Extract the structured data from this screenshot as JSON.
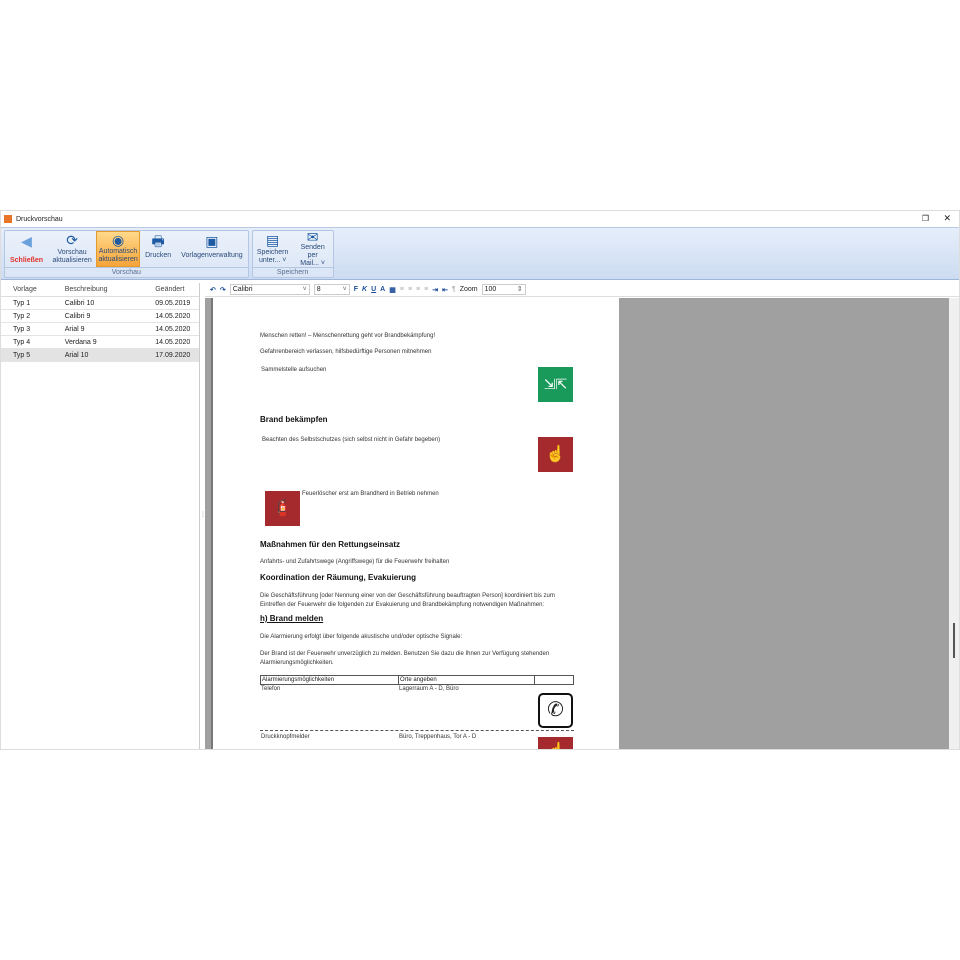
{
  "window": {
    "title": "Druckvorschau"
  },
  "ribbon": {
    "groups": [
      {
        "label": "Vorschau"
      },
      {
        "label": "Speichern"
      }
    ],
    "buttons": {
      "close": "Schließen",
      "refresh": "Vorschau aktualisieren",
      "auto": "Automatisch aktualisieren",
      "print": "Drucken",
      "templates": "Vorlagenverwaltung",
      "save": "Speichern unter... ˅",
      "mail": "Senden per Mail... ˅"
    }
  },
  "templates": {
    "headers": [
      "Vorlage",
      "Beschreibung",
      "Geändert"
    ],
    "rows": [
      [
        "Typ 1",
        "Calibri 10",
        "09.05.2019"
      ],
      [
        "Typ 2",
        "Calibri 9",
        "14.05.2020"
      ],
      [
        "Typ 3",
        "Arial 9",
        "14.05.2020"
      ],
      [
        "Typ 4",
        "Verdana 9",
        "14.05.2020"
      ],
      [
        "Typ 5",
        "Arial 10",
        "17.09.2020"
      ]
    ]
  },
  "editor": {
    "font": "Calibri",
    "size": "8",
    "bold": "F",
    "italic": "K",
    "underline": "U",
    "color": "A",
    "pilcrow": "¶",
    "zoom_label": "Zoom",
    "zoom": "100"
  },
  "document": {
    "p1": "Menschen retten! – Menschenrettung geht vor Brandbekämpfung!",
    "p2": "Gefahrenbereich verlassen, hilfsbedürftige Personen mitnehmen",
    "p3": "Sammelstelle aufsuchen",
    "h1": "Brand bekämpfen",
    "p4": "Beachten des Selbstschutzes (sich selbst nicht in Gefahr begeben)",
    "p5": "Feuerlöscher erst am Brandherd in Betrieb nehmen",
    "h2": "Maßnahmen für den Rettungseinsatz",
    "p6": "Anfahrts- und Zufahrtswege (Angriffswege) für die Feuerwehr freihalten",
    "h3": "Koordination der Räumung, Evakuierung",
    "p7": "Die Geschäftsführung [oder Nennung einer von der Geschäftsführung beauftragten Person] koordiniert bis zum Eintreffen der Feuerwehr die folgenden zur Evakuierung und Brandbekämpfung notwendigen Maßnahmen:",
    "h4": "h) Brand melden",
    "p8": "Die Alarmierung erfolgt über folgende akustische und/oder optische Signale:",
    "p9": "Der Brand ist der Feuerwehr unverzüglich zu melden. Benutzen Sie dazu die Ihnen zur Verfügung stehenden Alarmierungsmöglichkeiten.",
    "table": {
      "headers": [
        "Alarmierungsmöglichkeiten",
        "Orte angeben",
        ""
      ],
      "rows": [
        [
          "Telefon",
          "Lagerraum A - D, Büro"
        ],
        [
          "Druckknopfmelder",
          "Büro, Treppenhaus, Tor A - D"
        ]
      ]
    }
  },
  "colors": {
    "green": "#1a9a5a",
    "red": "#a52a2e",
    "accent": "#f6a43a"
  }
}
